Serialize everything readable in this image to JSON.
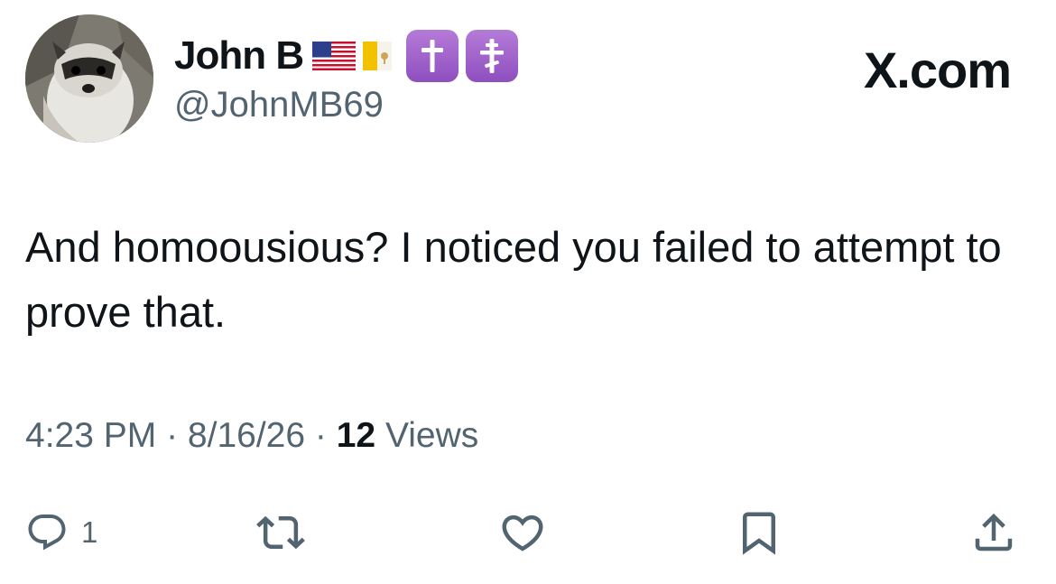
{
  "author": {
    "display_name": "John B",
    "handle": "@JohnMB69",
    "badges": [
      "us-flag",
      "vatican-flag",
      "latin-cross",
      "orthodox-cross"
    ]
  },
  "watermark": "X.com",
  "tweet": {
    "text": "And homoousious? I noticed you failed to attempt to prove that."
  },
  "meta": {
    "time": "4:23 PM",
    "separator": "·",
    "date": "8/16/26",
    "views_count": "12",
    "views_label": "Views"
  },
  "actions": {
    "reply_count": "1"
  },
  "colors": {
    "text": "#0f1419",
    "secondary": "#536471",
    "badge_purple": "#9b59c9"
  }
}
